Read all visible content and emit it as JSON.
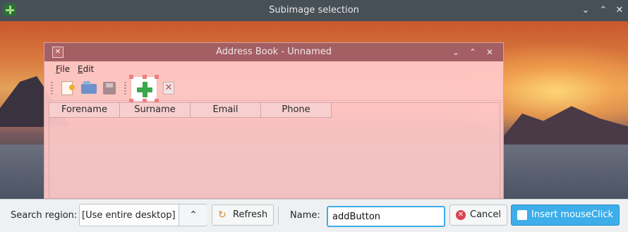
{
  "outer_window": {
    "title": "Subimage selection",
    "controls": [
      "chevron-down",
      "chevron-up",
      "close"
    ]
  },
  "inner_window": {
    "title": "Address Book - Unnamed",
    "menu": [
      {
        "label": "File",
        "mnemonic": "F",
        "rest": "ile"
      },
      {
        "label": "Edit",
        "mnemonic": "E",
        "rest": "dit"
      }
    ],
    "toolbar_icons": [
      "new-document-icon",
      "open-folder-icon",
      "save-icon",
      "add-contact-icon",
      "delete-contact-icon"
    ],
    "table": {
      "columns": [
        "Forename",
        "Surname",
        "Email",
        "Phone"
      ]
    }
  },
  "bottom_bar": {
    "search_region_label": "Search region:",
    "search_region_value": "[Use entire desktop]",
    "refresh_label": "Refresh",
    "name_label": "Name:",
    "name_value": "addButton",
    "cancel_label": "Cancel",
    "insert_label": "Insert mouseClick"
  },
  "colors": {
    "outer_titlebar": "#475057",
    "inner_titlebar": "#a35f64",
    "accent": "#3daee9",
    "selection_tint": "#ffc8c8"
  }
}
